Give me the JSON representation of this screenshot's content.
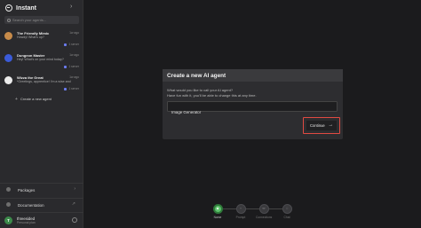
{
  "app": {
    "name": "Instant"
  },
  "search": {
    "placeholder": "Search your agents..."
  },
  "agents": [
    {
      "name": "The Friendly Mimic",
      "time": "1w ago",
      "message": "Howdy! What's up?",
      "footer": "1 server",
      "avatar_color": "#c78b4a"
    },
    {
      "name": "Dungeon Master",
      "time": "1w ago",
      "message": "Hey! What's on your mind today?",
      "footer": "1 server",
      "avatar_color": "#3b5bd9"
    },
    {
      "name": "Wizza the Great",
      "time": "1w ago",
      "message": "*Greetings, apprentice! I'm a wise and",
      "footer": "1 server",
      "avatar_color": "#ececec"
    }
  ],
  "create_agent_label": "Create a new agent",
  "bottom_links": [
    {
      "label": "Packages"
    },
    {
      "label": "Documentation"
    }
  ],
  "user": {
    "initial": "T",
    "name": "threesided",
    "plan": "Personal plan"
  },
  "dialog": {
    "title": "Create a new AI agent",
    "desc_line1": "What would you like to call your AI agent?",
    "desc_line2": "Have fun with it, you'll be able to change this at any time.",
    "input_value": "Image Generator",
    "continue_label": "Continue"
  },
  "steps": [
    {
      "label": "Name",
      "active": true
    },
    {
      "label": "Prompt",
      "active": false
    },
    {
      "label": "Connections",
      "active": false
    },
    {
      "label": "Chat",
      "active": false
    }
  ],
  "colors": {
    "accent_green": "#5cc26a",
    "highlight_red": "#e04a42"
  }
}
